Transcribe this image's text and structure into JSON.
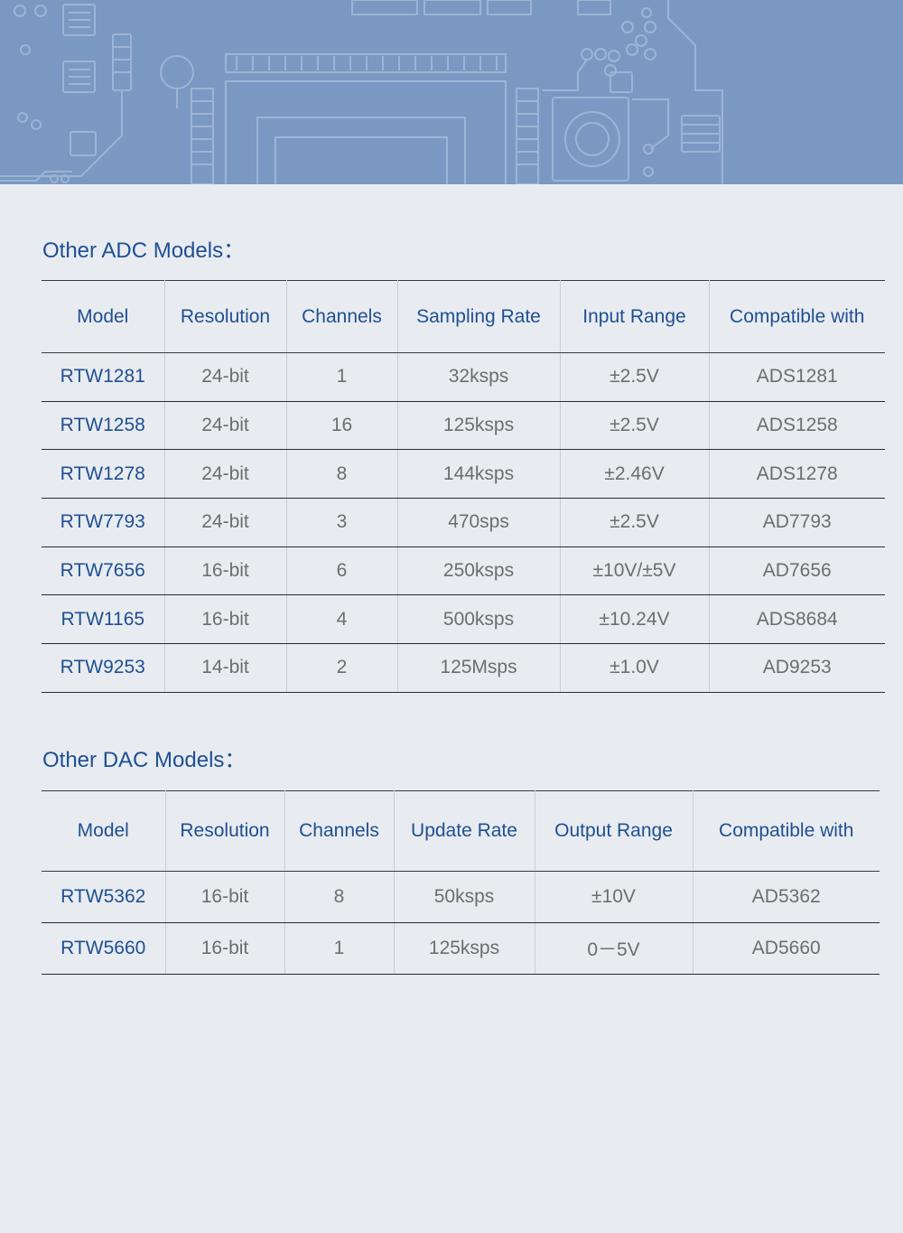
{
  "adc_section": {
    "title": "Other ADC Models：",
    "headers": [
      "Model",
      "Resolution",
      "Channels",
      "Sampling Rate",
      "Input Range",
      "Compatible with"
    ],
    "rows": [
      [
        "RTW1281",
        "24-bit",
        "1",
        "32ksps",
        "±2.5V",
        "ADS1281"
      ],
      [
        "RTW1258",
        "24-bit",
        "16",
        "125ksps",
        "±2.5V",
        "ADS1258"
      ],
      [
        "RTW1278",
        "24-bit",
        "8",
        "144ksps",
        "±2.46V",
        "ADS1278"
      ],
      [
        "RTW7793",
        "24-bit",
        "3",
        "470sps",
        "±2.5V",
        "AD7793"
      ],
      [
        "RTW7656",
        "16-bit",
        "6",
        "250ksps",
        "±10V/±5V",
        "AD7656"
      ],
      [
        "RTW1165",
        "16-bit",
        "4",
        "500ksps",
        "±10.24V",
        "ADS8684"
      ],
      [
        "RTW9253",
        "14-bit",
        "2",
        "125Msps",
        "±1.0V",
        "AD9253"
      ]
    ]
  },
  "dac_section": {
    "title": "Other DAC Models：",
    "headers": [
      "Model",
      "Resolution",
      "Channels",
      "Update Rate",
      "Output Range",
      "Compatible with"
    ],
    "rows": [
      [
        "RTW5362",
        "16-bit",
        "8",
        "50ksps",
        "±10V",
        "AD5362"
      ],
      [
        "RTW5660",
        "16-bit",
        "1",
        "125ksps",
        "0－5V",
        "AD5660"
      ]
    ]
  },
  "colors": {
    "banner": "#7b98c3",
    "background": "#e8ecf0",
    "heading_text": "#1f4f94",
    "cell_text": "#6d6d6d"
  }
}
